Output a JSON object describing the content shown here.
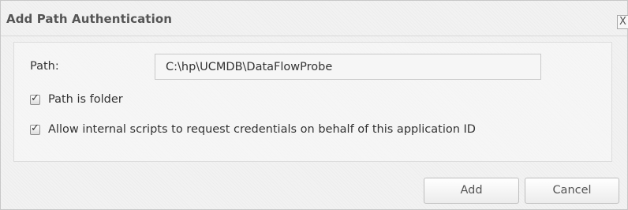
{
  "dialog": {
    "title": "Add Path Authentication",
    "close_glyph": "X"
  },
  "form": {
    "path_label": "Path:",
    "path_value": "C:\\hp\\UCMDB\\DataFlowProbe",
    "path_is_folder_label": "Path is folder",
    "path_is_folder_checked": true,
    "allow_internal_label": "Allow internal scripts to request credentials on behalf of this application ID",
    "allow_internal_checked": true,
    "check_glyph": "✓"
  },
  "buttons": {
    "add_label": "Add",
    "cancel_label": "Cancel"
  }
}
